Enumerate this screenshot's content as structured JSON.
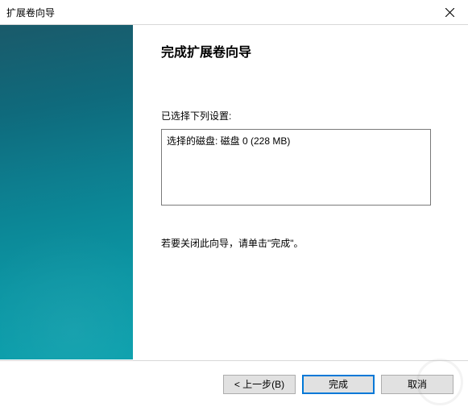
{
  "window": {
    "title": "扩展卷向导"
  },
  "heading": "完成扩展卷向导",
  "settings_label": "已选择下列设置:",
  "selected_disk_line": "选择的磁盘: 磁盘 0 (228 MB)",
  "instruction": "若要关闭此向导，请单击\"完成\"。",
  "buttons": {
    "back": "< 上一步(B)",
    "finish": "完成",
    "cancel": "取消"
  }
}
